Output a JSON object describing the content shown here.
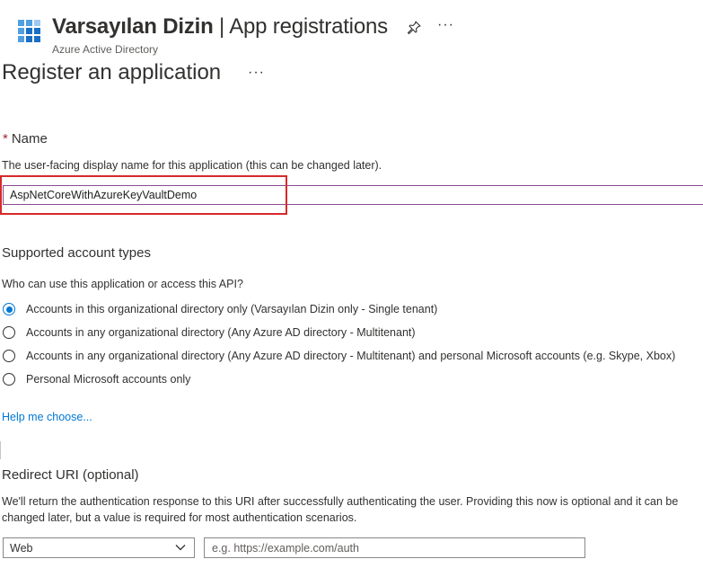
{
  "header": {
    "title_main": "Varsayılan Dizin",
    "title_sep": " | ",
    "title_section": "App registrations",
    "subtitle": "Azure Active Directory",
    "pin_icon": "pin-icon",
    "more_label": "···"
  },
  "page": {
    "title": "Register an application",
    "more_label": "···"
  },
  "name_section": {
    "required_mark": "*",
    "label": "Name",
    "helper": "The user-facing display name for this application (this can be changed later).",
    "value": "AspNetCoreWithAzureKeyVaultDemo"
  },
  "account_types": {
    "heading": "Supported account types",
    "question": "Who can use this application or access this API?",
    "options": [
      {
        "label": "Accounts in this organizational directory only (Varsayılan Dizin only - Single tenant)",
        "selected": true
      },
      {
        "label": "Accounts in any organizational directory (Any Azure AD directory - Multitenant)",
        "selected": false
      },
      {
        "label": "Accounts in any organizational directory (Any Azure AD directory - Multitenant) and personal Microsoft accounts (e.g. Skype, Xbox)",
        "selected": false
      },
      {
        "label": "Personal Microsoft accounts only",
        "selected": false
      }
    ],
    "help_link": "Help me choose..."
  },
  "redirect": {
    "heading": "Redirect URI (optional)",
    "description": "We'll return the authentication response to this URI after successfully authenticating the user. Providing this now is optional and it can be changed later, but a value is required for most authentication scenarios.",
    "platform_selected": "Web",
    "uri_placeholder": "e.g. https://example.com/auth",
    "uri_value": ""
  },
  "colors": {
    "accent": "#0078d4",
    "required": "#a4262c",
    "highlight_box": "#d62a2a",
    "input_focus_border": "#8a4b8f"
  }
}
